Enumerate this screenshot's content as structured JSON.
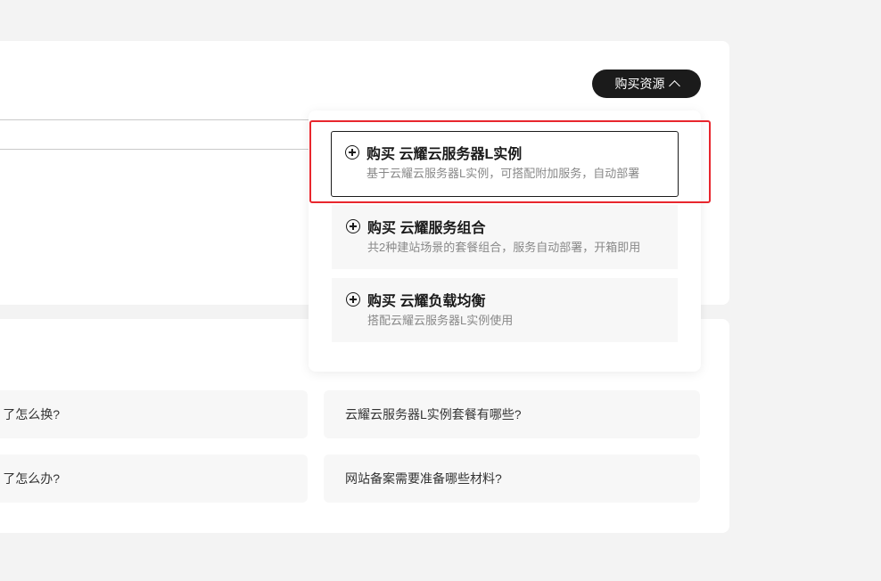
{
  "header": {
    "buy_button_label": "购买资源"
  },
  "dropdown": {
    "options": [
      {
        "title": "购买 云耀云服务器L实例",
        "desc": "基于云耀云服务器L实例，可搭配附加服务，自动部署",
        "icon": "plus-circle-icon"
      },
      {
        "title": "购买 云耀服务组合",
        "desc": "共2种建站场景的套餐组合，服务自动部署，开箱即用",
        "icon": "plus-circle-icon"
      },
      {
        "title": "购买 云耀负载均衡",
        "desc": "搭配云耀云服务器L实例使用",
        "icon": "plus-circle-icon"
      }
    ],
    "highlight_color": "#e8262d"
  },
  "faq": {
    "items": [
      "了怎么换?",
      "云耀云服务器L实例套餐有哪些?",
      "了怎么办?",
      "网站备案需要准备哪些材料?"
    ]
  }
}
